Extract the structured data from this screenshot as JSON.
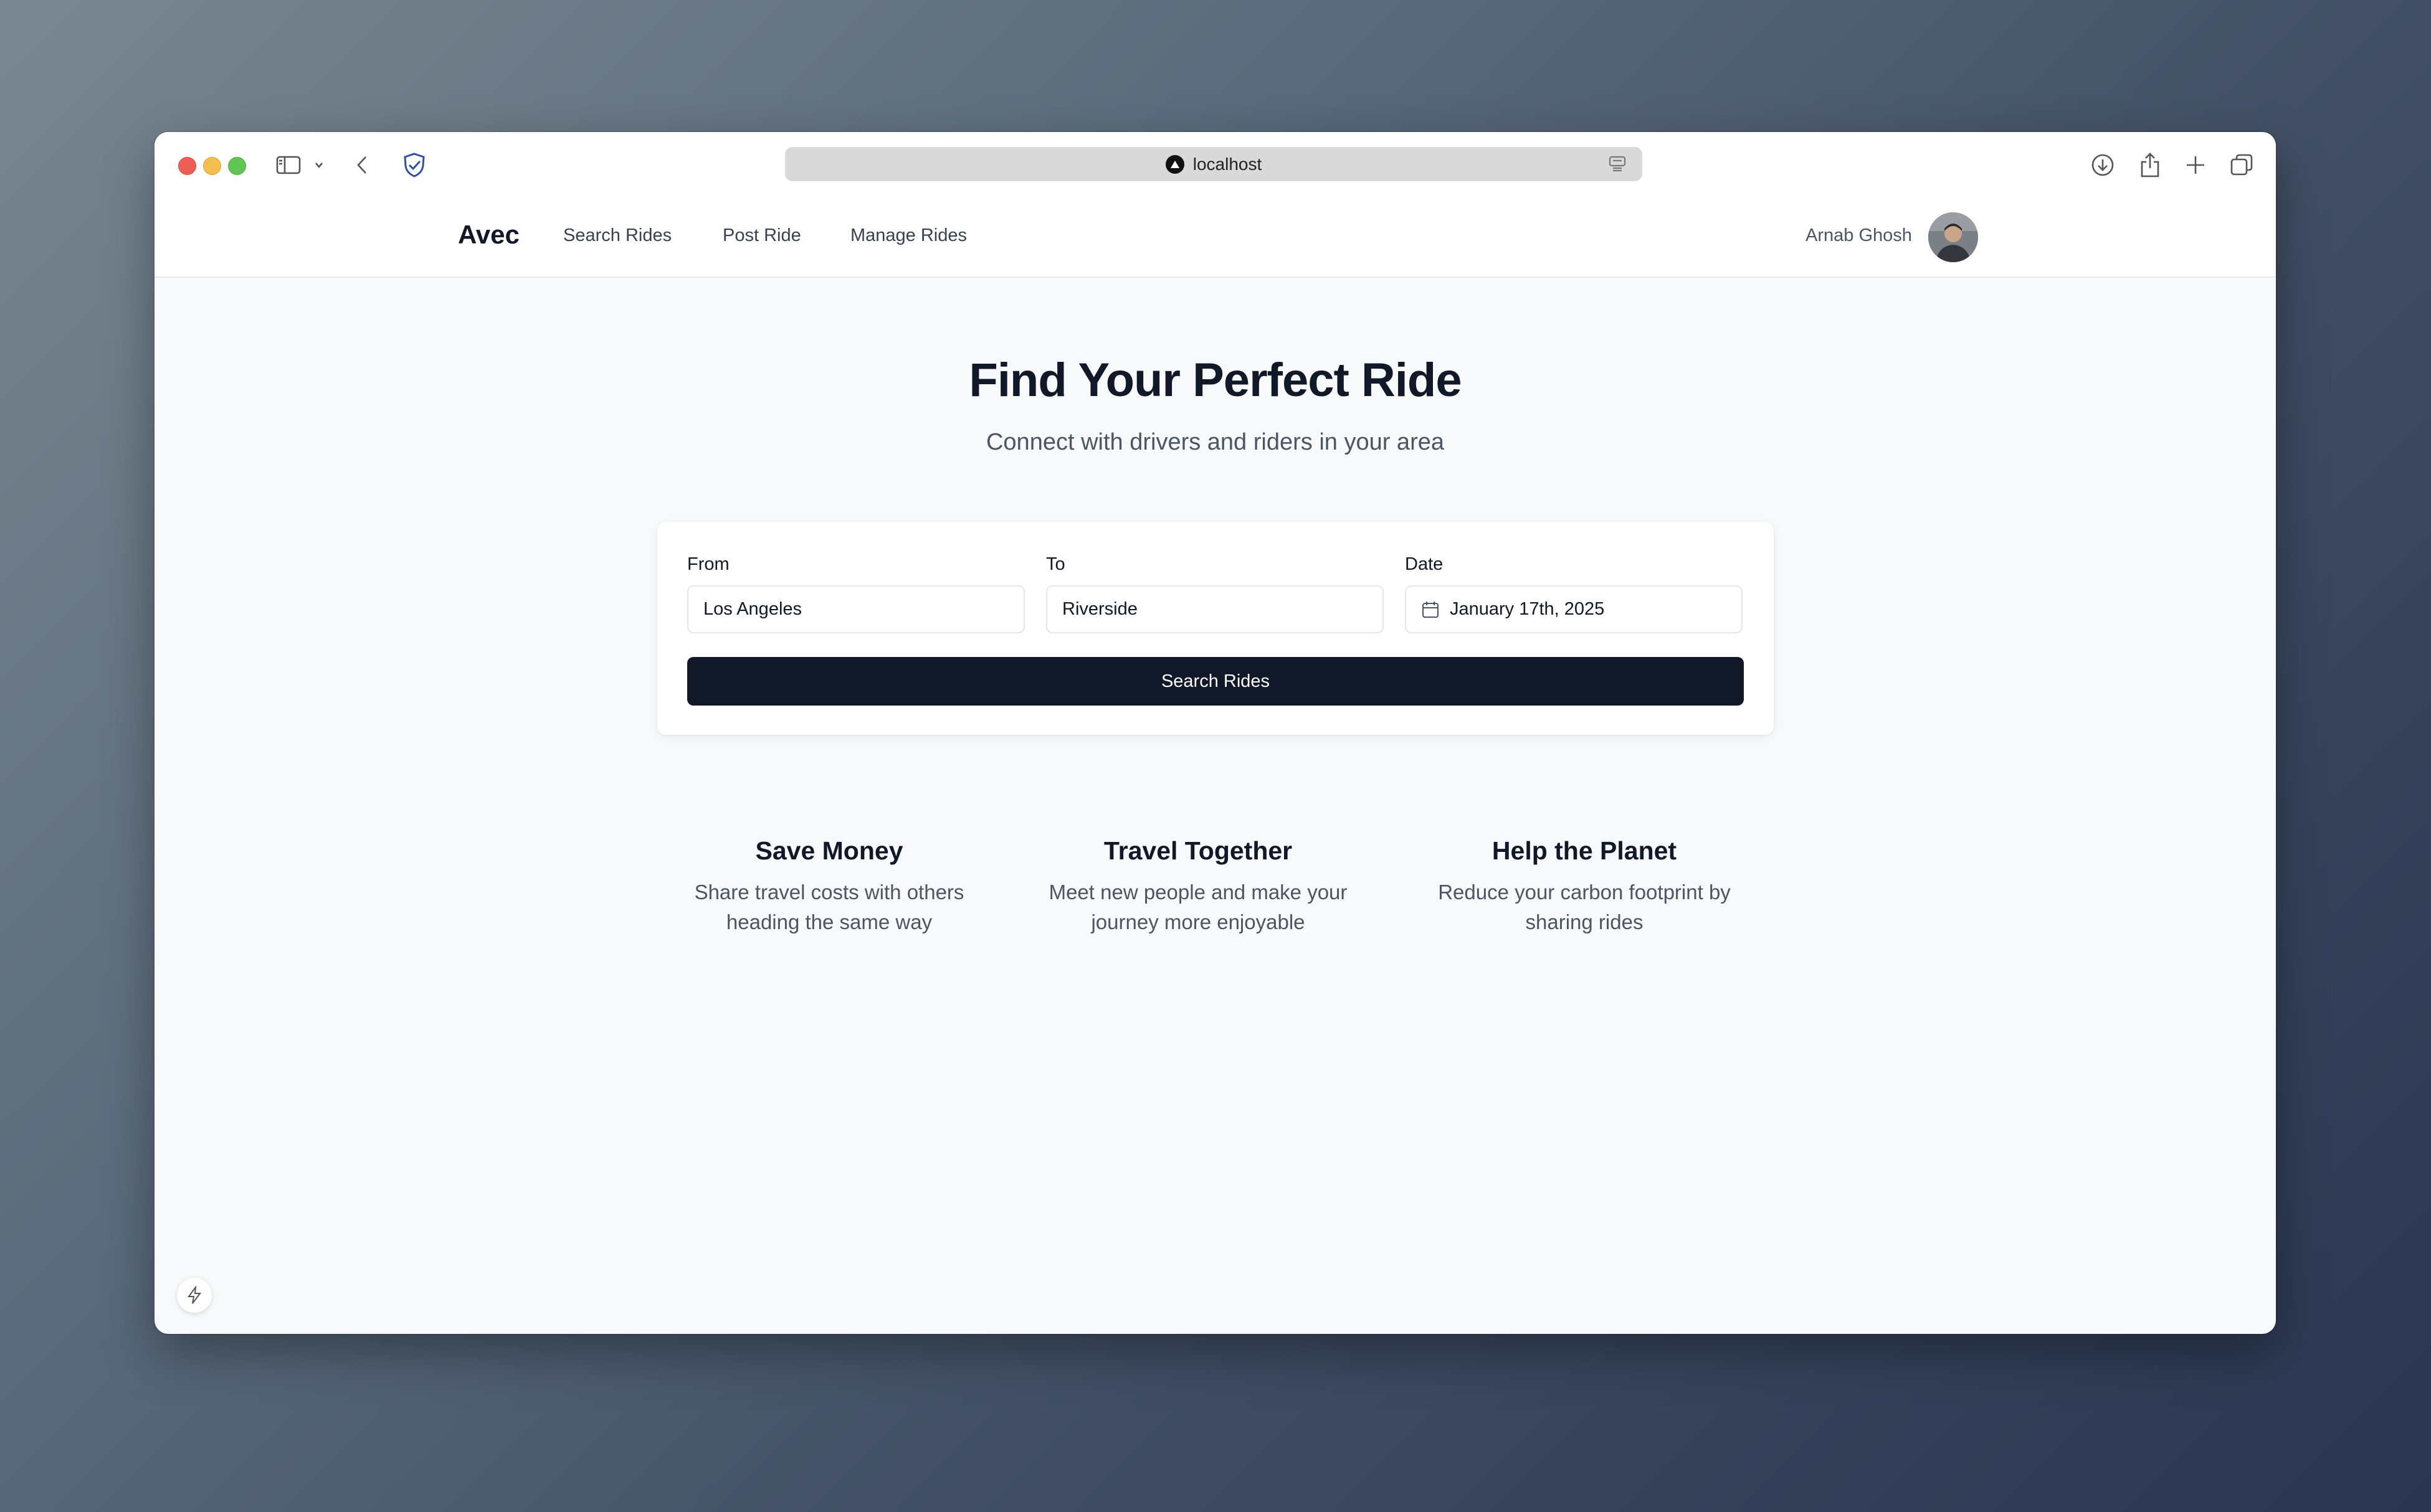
{
  "browser": {
    "url": "localhost"
  },
  "nav": {
    "brand": "Avec",
    "links": [
      "Search Rides",
      "Post Ride",
      "Manage Rides"
    ],
    "user_name": "Arnab Ghosh"
  },
  "hero": {
    "title": "Find Your Perfect Ride",
    "subtitle": "Connect with drivers and riders in your area"
  },
  "search": {
    "from_label": "From",
    "from_value": "Los Angeles",
    "to_label": "To",
    "to_value": "Riverside",
    "date_label": "Date",
    "date_value": "January 17th, 2025",
    "button_label": "Search Rides"
  },
  "features": [
    {
      "title": "Save Money",
      "lines": [
        "Share travel costs with others",
        "heading the same way"
      ]
    },
    {
      "title": "Travel Together",
      "lines": [
        "Meet new people and make your",
        "journey more enjoyable"
      ]
    },
    {
      "title": "Help the Planet",
      "lines": [
        "Reduce your carbon footprint by",
        "sharing rides"
      ]
    }
  ],
  "colors": {
    "primary": "#111827",
    "muted_text": "#4b5563",
    "page_bg": "#f8f9fb"
  }
}
